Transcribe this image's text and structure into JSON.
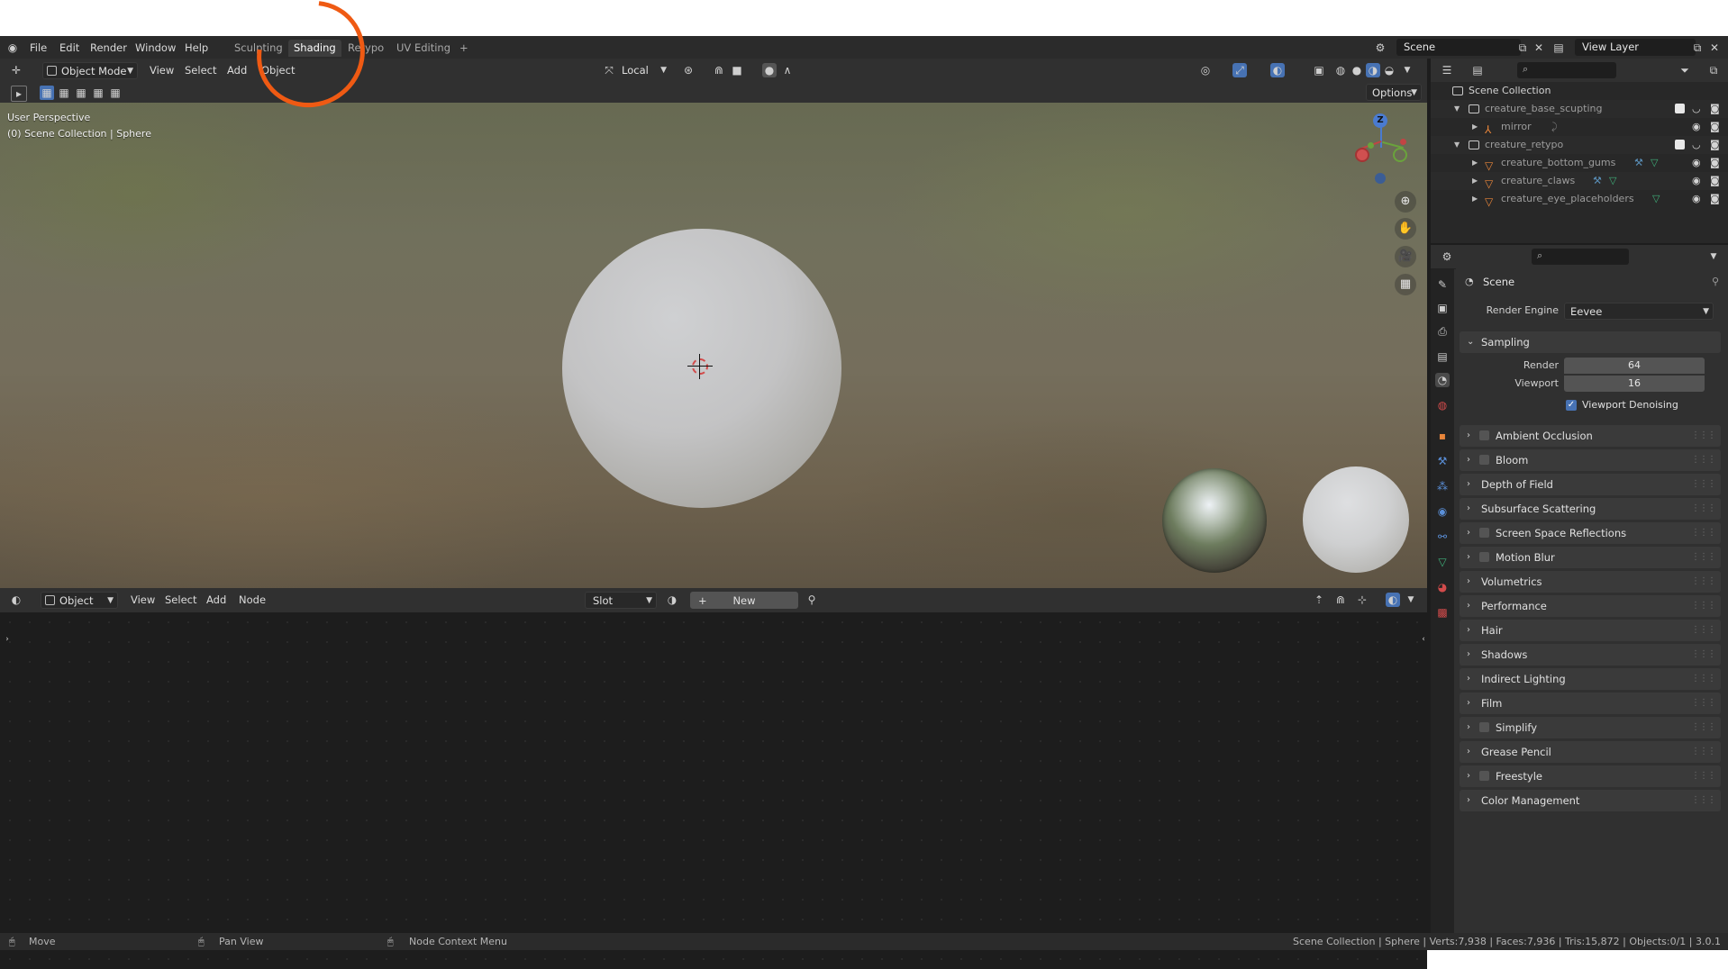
{
  "topbar": {
    "menus": [
      "File",
      "Edit",
      "Render",
      "Window",
      "Help"
    ],
    "workspace_tabs": [
      "Sculpting",
      "Shading",
      "Retypo",
      "UV Editing"
    ],
    "active_tab": "Shading",
    "add_tab": "+",
    "scene": "Scene",
    "view_layer": "View Layer"
  },
  "viewport": {
    "mode": "Object Mode",
    "menus": [
      "View",
      "Select",
      "Add",
      "Object"
    ],
    "transform_orientation": "Local",
    "options_label": "Options",
    "perspective_label": "User Perspective",
    "context_label": "(0) Scene Collection | Sphere",
    "gizmo_axis": "Z"
  },
  "node_editor": {
    "mode": "Object",
    "menus": [
      "View",
      "Select",
      "Add",
      "Node"
    ],
    "slot": "Slot",
    "new_label": "New",
    "new_plus": "+"
  },
  "outliner": {
    "root": "Scene Collection",
    "rows": [
      {
        "name": "creature_base_scupting",
        "kind": "collection",
        "checked": true
      },
      {
        "name": "mirror",
        "kind": "object"
      },
      {
        "name": "creature_retypo",
        "kind": "collection",
        "checked": true
      },
      {
        "name": "creature_bottom_gums",
        "kind": "mesh"
      },
      {
        "name": "creature_claws",
        "kind": "mesh"
      },
      {
        "name": "creature_eye_placeholders",
        "kind": "mesh"
      }
    ]
  },
  "properties": {
    "title": "Scene",
    "render_engine_label": "Render Engine",
    "render_engine": "Eevee",
    "sampling": {
      "title": "Sampling",
      "render_label": "Render",
      "render_value": "64",
      "viewport_label": "Viewport",
      "viewport_value": "16",
      "denoise_label": "Viewport Denoising",
      "denoise_checked": true
    },
    "panels": [
      {
        "label": "Ambient Occlusion",
        "checkbox": true
      },
      {
        "label": "Bloom",
        "checkbox": true
      },
      {
        "label": "Depth of Field",
        "checkbox": false
      },
      {
        "label": "Subsurface Scattering",
        "checkbox": false
      },
      {
        "label": "Screen Space Reflections",
        "checkbox": true
      },
      {
        "label": "Motion Blur",
        "checkbox": true
      },
      {
        "label": "Volumetrics",
        "checkbox": false
      },
      {
        "label": "Performance",
        "checkbox": false
      },
      {
        "label": "Hair",
        "checkbox": false
      },
      {
        "label": "Shadows",
        "checkbox": false
      },
      {
        "label": "Indirect Lighting",
        "checkbox": false
      },
      {
        "label": "Film",
        "checkbox": false
      },
      {
        "label": "Simplify",
        "checkbox": true
      },
      {
        "label": "Grease Pencil",
        "checkbox": false
      },
      {
        "label": "Freestyle",
        "checkbox": true
      },
      {
        "label": "Color Management",
        "checkbox": false
      }
    ]
  },
  "statusbar": {
    "move": "Move",
    "pan": "Pan View",
    "context_menu": "Node Context Menu",
    "stats": "Scene Collection | Sphere | Verts:7,938 | Faces:7,936 | Tris:15,872 | Objects:0/1 | 3.0.1"
  },
  "colors": {
    "accent": "#4772b3",
    "annotation": "#ef5a13",
    "mesh_icon": "#e8853a"
  }
}
